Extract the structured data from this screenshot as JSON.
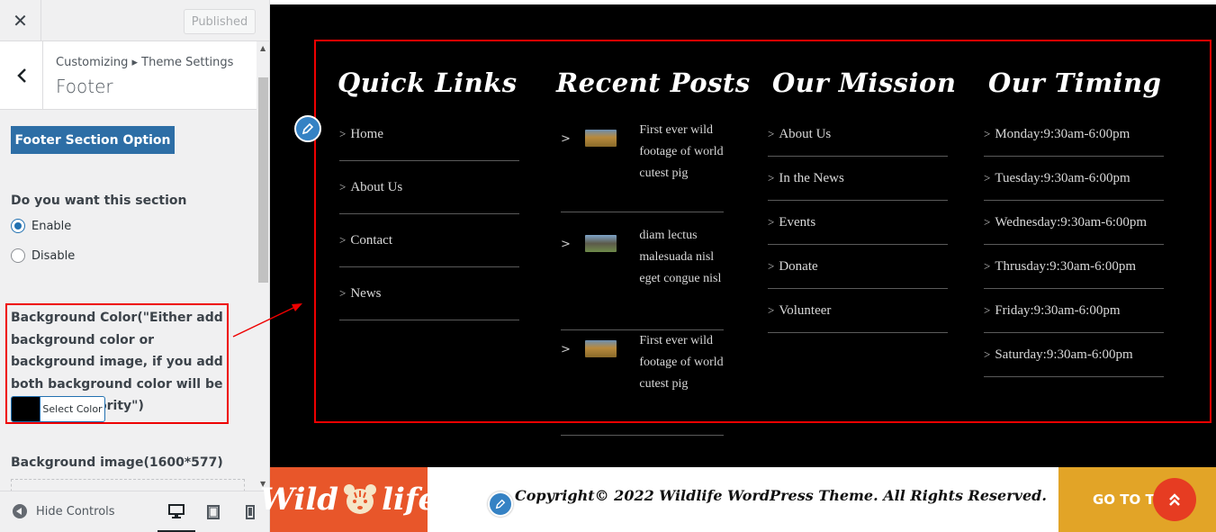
{
  "sidebar": {
    "close_label": "✕",
    "published_label": "Published",
    "breadcrumb": "Customizing ▸ Theme Settings",
    "section_title": "Footer",
    "footer_section_button": "Footer Section Option",
    "question_label": "Do you want this section",
    "radio_options": [
      {
        "label": "Enable",
        "checked": true
      },
      {
        "label": "Disable",
        "checked": false
      }
    ],
    "bg_color_label": "Background Color(\"Either add background color or background image, if you add both background color will be top most priority\")",
    "select_color_label": "Select Color",
    "selected_color": "#000000",
    "bg_image_label": "Background image(1600*577)",
    "hide_controls_label": "Hide Controls",
    "devices": [
      "desktop",
      "tablet",
      "mobile"
    ],
    "active_device": "desktop"
  },
  "preview": {
    "quick_links": {
      "title": "Quick Links",
      "items": [
        "Home",
        "About Us",
        "Contact",
        "News"
      ]
    },
    "recent_posts": {
      "title": "Recent Posts",
      "items": [
        {
          "text": "First ever wild footage of world cutest pig",
          "thumb": "lion"
        },
        {
          "text": "diam lectus malesuada nisl eget congue nisl",
          "thumb": "elephants"
        },
        {
          "text": "First ever wild footage of world cutest pig",
          "thumb": "lion"
        }
      ]
    },
    "our_mission": {
      "title": "Our Mission",
      "items": [
        "About Us",
        "In the News",
        "Events",
        "Donate",
        "Volunteer"
      ]
    },
    "our_timing": {
      "title": "Our Timing",
      "items": [
        "Monday:9:30am-6:00pm",
        "Tuesday:9:30am-6:00pm",
        "Wednesday:9:30am-6:00pm",
        "Thrusday:9:30am-6:00pm",
        "Friday:9:30am-6:00pm",
        "Saturday:9:30am-6:00pm"
      ]
    },
    "logo": {
      "left": "Wild",
      "right": "life"
    },
    "copyright": "Copyright© 2022 Wildlife WordPress Theme. All Rights Reserved.",
    "goto_label": "GO TO THE",
    "colors": {
      "footer_bg": "#000000",
      "logo_bg": "#e8562a",
      "goto_bg": "#e2a427",
      "scroll_top_bg": "#e63c22",
      "highlight": "#ee0000",
      "edit_shortcut": "#3582c4",
      "primary_button": "#2d6ea6"
    }
  }
}
